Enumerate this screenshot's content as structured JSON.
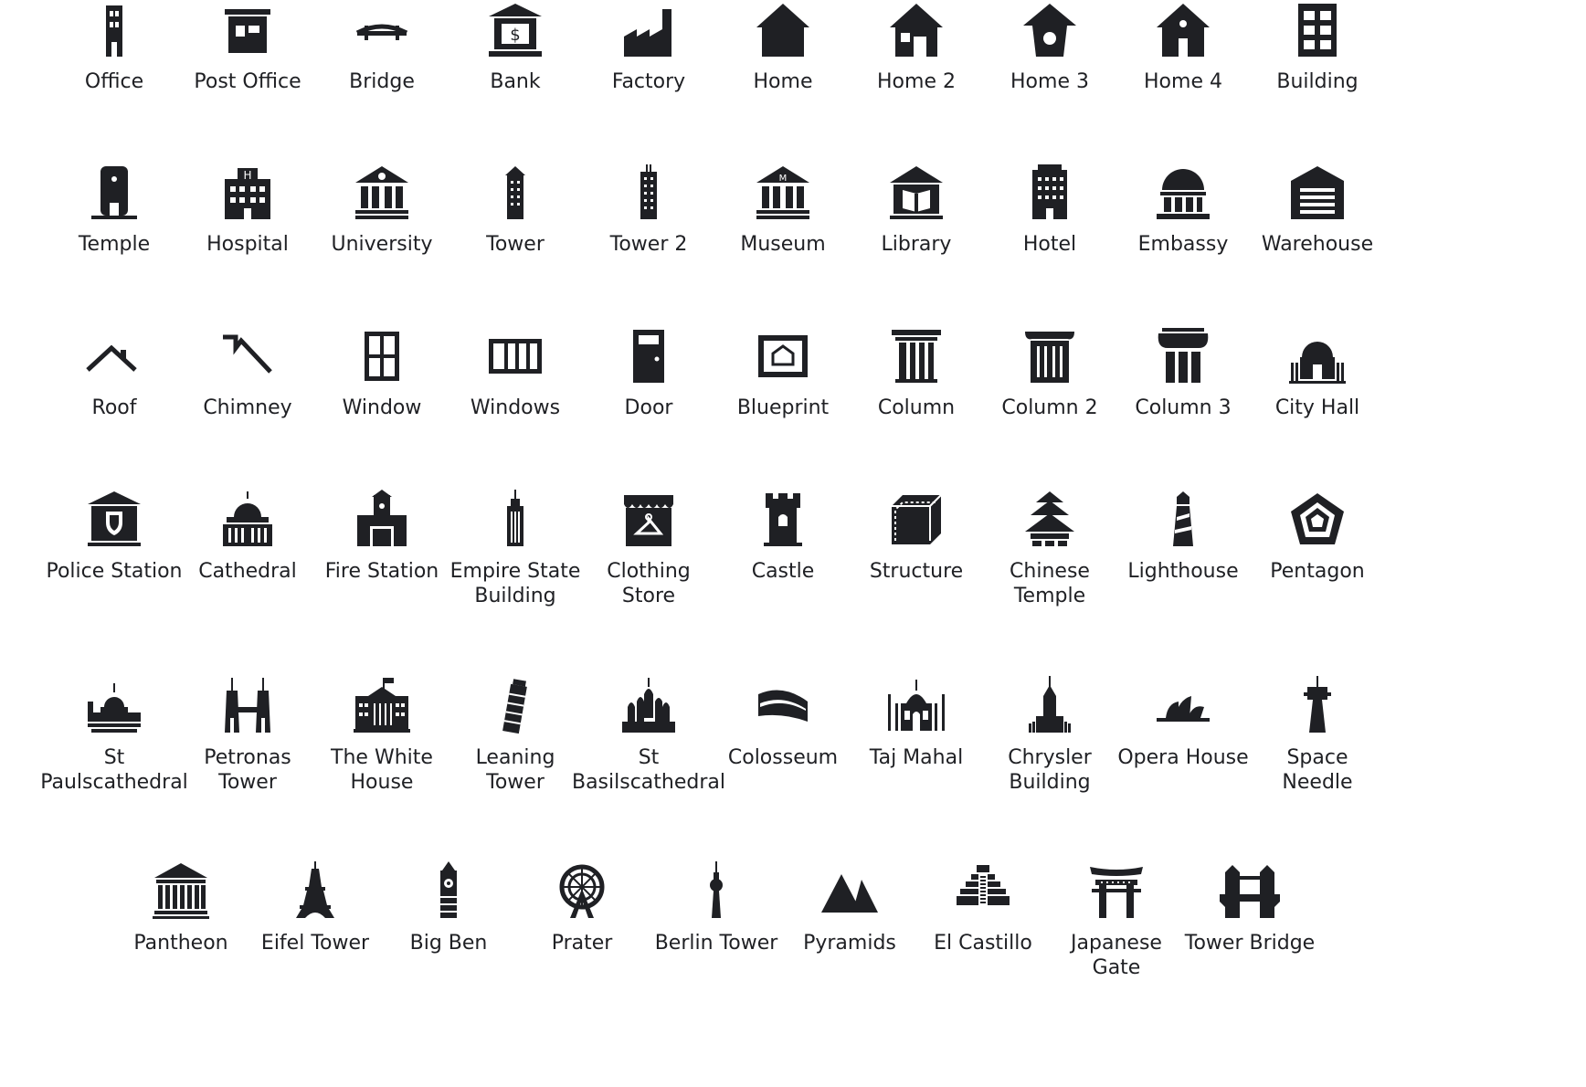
{
  "rows": [
    [
      "Office",
      "Post Office",
      "Bridge",
      "Bank",
      "Factory",
      "Home",
      "Home 2",
      "Home 3",
      "Home 4",
      "Building"
    ],
    [
      "Temple",
      "Hospital",
      "University",
      "Tower",
      "Tower 2",
      "Museum",
      "Library",
      "Hotel",
      "Embassy",
      "Warehouse"
    ],
    [
      "Roof",
      "Chimney",
      "Window",
      "Windows",
      "Door",
      "Blueprint",
      "Column",
      "Column 2",
      "Column 3",
      "City Hall"
    ],
    [
      "Police Station",
      "Cathedral",
      "Fire Station",
      "Empire State\nBuilding",
      "Clothing\nStore",
      "Castle",
      "Structure",
      "Chinese\nTemple",
      "Lighthouse",
      "Pentagon"
    ],
    [
      "St\nPaulscathedral",
      "Petronas\nTower",
      "The White\nHouse",
      "Leaning\nTower",
      "St\nBasilscathedral",
      "Colosseum",
      "Taj Mahal",
      "Chrysler\nBuilding",
      "Opera House",
      "Space\nNeedle"
    ],
    [
      "Pantheon",
      "Eifel Tower",
      "Big Ben",
      "Prater",
      "Berlin Tower",
      "Pyramids",
      "El Castillo",
      "Japanese\nGate",
      "Tower Bridge"
    ]
  ],
  "icon_names": [
    [
      "office-icon",
      "post-office-icon",
      "bridge-icon",
      "bank-icon",
      "factory-icon",
      "home-icon",
      "home-2-icon",
      "home-3-icon",
      "home-4-icon",
      "building-icon"
    ],
    [
      "temple-icon",
      "hospital-icon",
      "university-icon",
      "tower-icon",
      "tower-2-icon",
      "museum-icon",
      "library-icon",
      "hotel-icon",
      "embassy-icon",
      "warehouse-icon"
    ],
    [
      "roof-icon",
      "chimney-icon",
      "window-icon",
      "windows-icon",
      "door-icon",
      "blueprint-icon",
      "column-icon",
      "column-2-icon",
      "column-3-icon",
      "city-hall-icon"
    ],
    [
      "police-station-icon",
      "cathedral-icon",
      "fire-station-icon",
      "empire-state-building-icon",
      "clothing-store-icon",
      "castle-icon",
      "structure-icon",
      "chinese-temple-icon",
      "lighthouse-icon",
      "pentagon-icon"
    ],
    [
      "st-paulscathedral-icon",
      "petronas-tower-icon",
      "white-house-icon",
      "leaning-tower-icon",
      "st-basilscathedral-icon",
      "colosseum-icon",
      "taj-mahal-icon",
      "chrysler-building-icon",
      "opera-house-icon",
      "space-needle-icon"
    ],
    [
      "pantheon-icon",
      "eifel-tower-icon",
      "big-ben-icon",
      "prater-icon",
      "berlin-tower-icon",
      "pyramids-icon",
      "el-castillo-icon",
      "japanese-gate-icon",
      "tower-bridge-icon"
    ]
  ],
  "colors": {
    "icon": "#1f2024",
    "text": "#1f2024",
    "background": "#ffffff"
  }
}
